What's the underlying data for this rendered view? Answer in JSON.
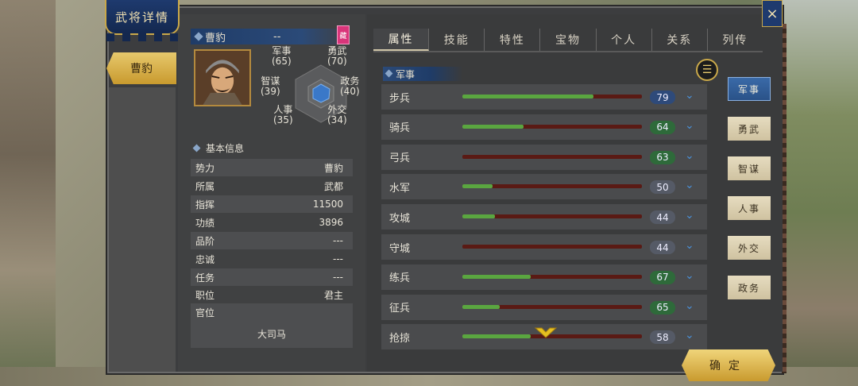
{
  "window": {
    "title": "武将详情",
    "close_icon": "×"
  },
  "general": {
    "name": "曹豹",
    "subtitle": "--",
    "tag": "藏"
  },
  "stats": {
    "military": {
      "label": "军事",
      "value": "(65)"
    },
    "valor": {
      "label": "勇武",
      "value": "(70)"
    },
    "strategy": {
      "label": "智谋",
      "value": "(39)"
    },
    "politics": {
      "label": "政务",
      "value": "(40)"
    },
    "personnel": {
      "label": "人事",
      "value": "(35)"
    },
    "diplomacy": {
      "label": "外交",
      "value": "(34)"
    }
  },
  "info": {
    "title": "基本信息",
    "rows": [
      {
        "label": "势力",
        "value": "曹豹"
      },
      {
        "label": "所属",
        "value": "武都"
      },
      {
        "label": "指挥",
        "value": "11500"
      },
      {
        "label": "功绩",
        "value": "3896"
      },
      {
        "label": "品阶",
        "value": "---"
      },
      {
        "label": "忠诚",
        "value": "---"
      },
      {
        "label": "任务",
        "value": "---"
      },
      {
        "label": "职位",
        "value": "君主"
      },
      {
        "label": "官位",
        "value": ""
      }
    ],
    "office": "大司马"
  },
  "tabs": [
    "属性",
    "技能",
    "特性",
    "宝物",
    "个人",
    "关系",
    "列传"
  ],
  "section": {
    "title": "军事",
    "list_icon": "list-icon"
  },
  "skills": [
    {
      "name": "步兵",
      "value": "79",
      "fill": 0.73,
      "badge": "blue"
    },
    {
      "name": "骑兵",
      "value": "64",
      "fill": 0.34,
      "badge": "green"
    },
    {
      "name": "弓兵",
      "value": "63",
      "fill": 0.0,
      "badge": "green"
    },
    {
      "name": "水军",
      "value": "50",
      "fill": 0.17,
      "badge": "grey"
    },
    {
      "name": "攻城",
      "value": "44",
      "fill": 0.18,
      "badge": "grey"
    },
    {
      "name": "守城",
      "value": "44",
      "fill": 0.0,
      "badge": "grey"
    },
    {
      "name": "练兵",
      "value": "67",
      "fill": 0.38,
      "badge": "green"
    },
    {
      "name": "征兵",
      "value": "65",
      "fill": 0.21,
      "badge": "green"
    },
    {
      "name": "抢掠",
      "value": "58",
      "fill": 0.38,
      "badge": "grey"
    }
  ],
  "side_tabs": [
    "军事",
    "勇武",
    "智谋",
    "人事",
    "外交",
    "政务"
  ],
  "confirm_label": "确定",
  "colors": {
    "accent_gold": "#c9a84a",
    "bar_green": "#5aa640",
    "bar_red": "#5a1a14",
    "panel": "#3a3b3c"
  }
}
